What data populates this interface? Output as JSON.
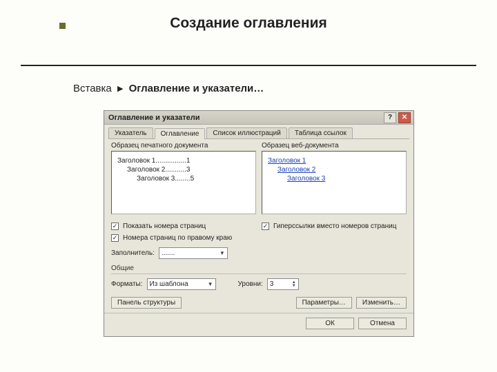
{
  "slide": {
    "title": "Создание оглавления",
    "breadcrumb_a": "Вставка",
    "breadcrumb_b": "Оглавление и указатели…"
  },
  "dialog": {
    "title": "Оглавление и указатели",
    "help": "?",
    "close": "✕",
    "tabs": [
      "Указатель",
      "Оглавление",
      "Список иллюстраций",
      "Таблица ссылок"
    ],
    "active_tab": 1,
    "print_preview_label": "Образец печатного документа",
    "web_preview_label": "Образец веб-документа",
    "print_lines": {
      "l1": "Заголовок 1",
      "p1": "1",
      "l2": "Заголовок 2",
      "p2": "3",
      "l3": "Заголовок 3",
      "p3": "5"
    },
    "web_lines": {
      "l1": "Заголовок 1",
      "l2": "Заголовок 2",
      "l3": "Заголовок 3"
    },
    "show_page_numbers": "Показать номера страниц",
    "right_align_numbers": "Номера страниц по правому краю",
    "hyperlinks_instead": "Гиперссылки вместо номеров страниц",
    "filler_label": "Заполнитель:",
    "filler_value": ".......",
    "section_general": "Общие",
    "format_label": "Форматы:",
    "format_value": "Из шаблона",
    "levels_label": "Уровни:",
    "levels_value": "3",
    "btn_outline": "Панель структуры",
    "btn_params": "Параметры…",
    "btn_modify": "Изменить…",
    "btn_ok": "ОК",
    "btn_cancel": "Отмена"
  }
}
